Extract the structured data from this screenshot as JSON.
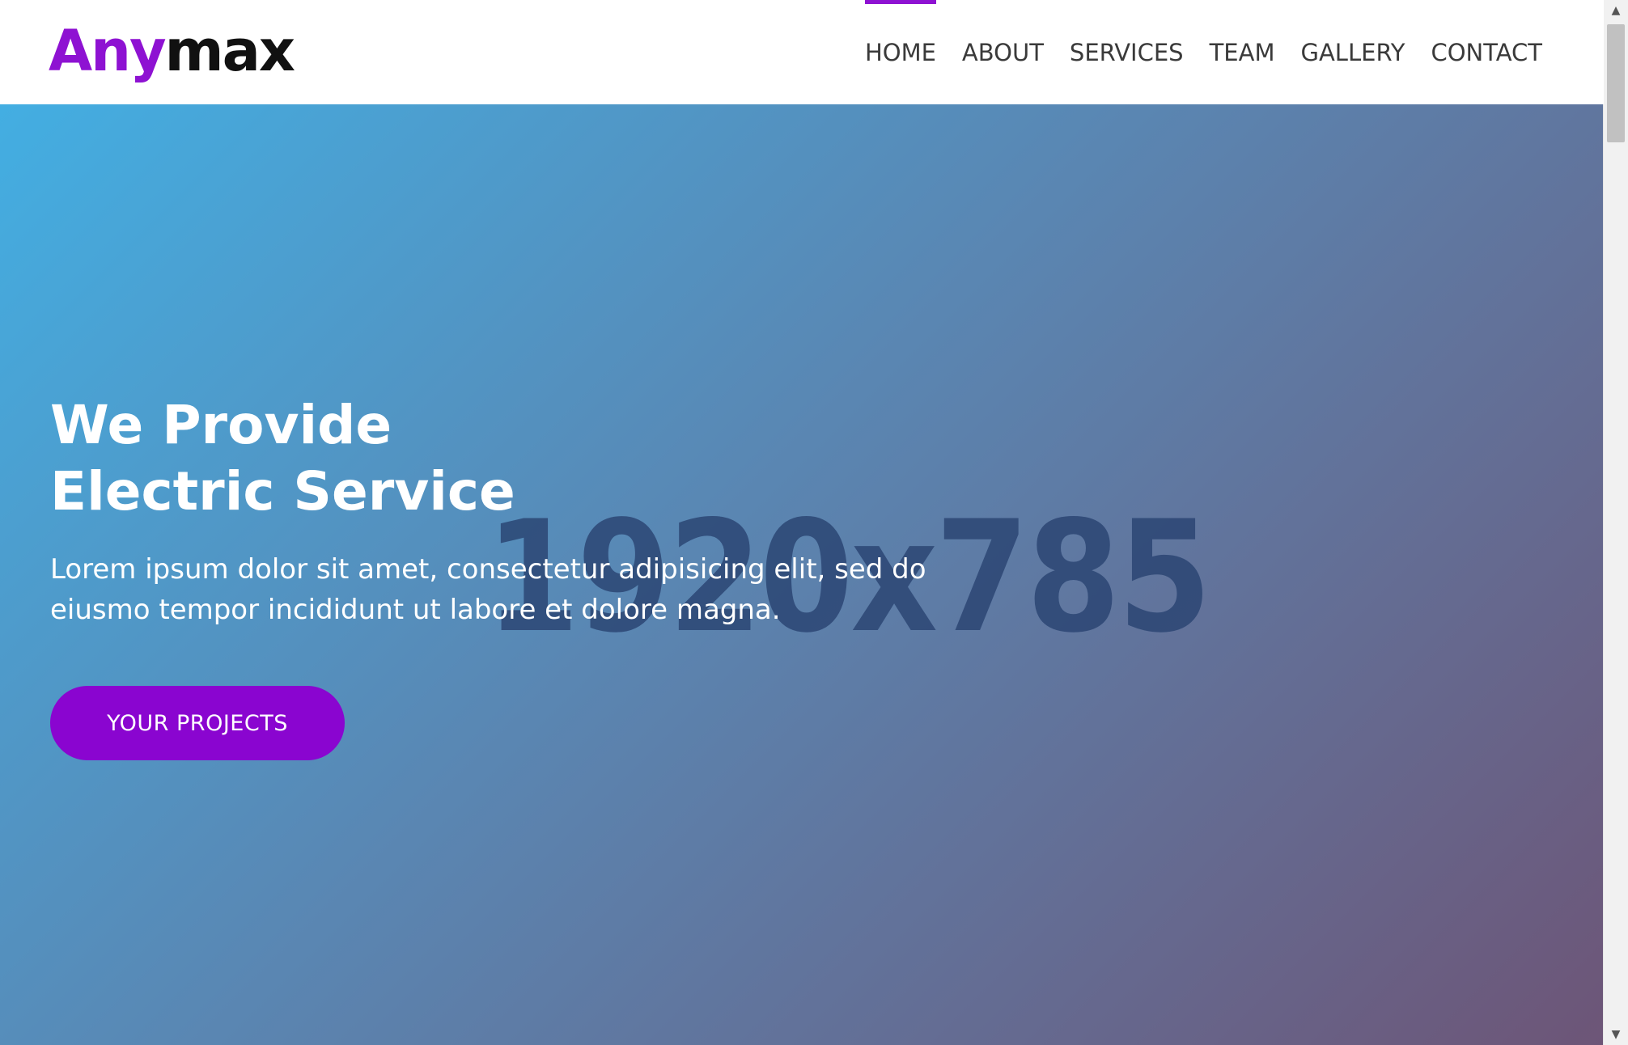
{
  "logo": {
    "part1": "Any",
    "part2": "max"
  },
  "nav": {
    "items": [
      {
        "label": "HOME",
        "active": true
      },
      {
        "label": "ABOUT"
      },
      {
        "label": "SERVICES"
      },
      {
        "label": "TEAM"
      },
      {
        "label": "GALLERY"
      },
      {
        "label": "CONTACT"
      }
    ]
  },
  "hero": {
    "title_line1": "We Provide",
    "title_line2": "Electric Service",
    "text": "Lorem ipsum dolor sit amet, consectetur adipisicing elit, sed do eiusmo tempor incididunt ut labore et dolore magna.",
    "button_label": "YOUR PROJECTS",
    "placeholder_label": "1920x785"
  },
  "colors": {
    "brand": "#8e12d2",
    "button": "#8a05d0",
    "gradient_start": "#43aee2",
    "gradient_end": "#6d5577"
  },
  "icons": {
    "scroll_up": "chevron-up-icon",
    "scroll_down": "chevron-down-icon"
  }
}
